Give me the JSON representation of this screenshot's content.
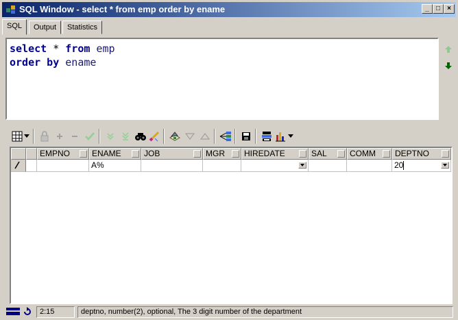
{
  "window": {
    "title": "SQL Window - select * from emp order by ename",
    "controls": [
      "_",
      "□",
      "×"
    ]
  },
  "tabs": [
    {
      "label": "SQL"
    },
    {
      "label": "Output"
    },
    {
      "label": "Statistics"
    }
  ],
  "editor": {
    "line1": {
      "kw1": "select",
      "mid": " * ",
      "kw2": "from",
      "id": " emp"
    },
    "line2": {
      "kw1": "order by",
      "id": " ename"
    }
  },
  "toolbar": {
    "icons": [
      "grid-select-icon",
      "dropdown-icon",
      "lock-icon",
      "add-record-icon",
      "delete-record-icon",
      "post-icon",
      "next-page-icon",
      "last-page-icon",
      "find-icon",
      "clear-icon",
      "query-by-example-icon",
      "filter-icon",
      "sort-icon",
      "export-icon",
      "save-icon",
      "print-icon",
      "chart-icon"
    ]
  },
  "grid": {
    "columns": [
      "EMPNO",
      "ENAME",
      "JOB",
      "MGR",
      "HIREDATE",
      "SAL",
      "COMM",
      "DEPTNO"
    ],
    "row": {
      "EMPNO": "",
      "ENAME": "A%",
      "JOB": "",
      "MGR": "",
      "HIREDATE": "",
      "SAL": "",
      "COMM": "",
      "DEPTNO": "20"
    }
  },
  "status": {
    "position": "2:15",
    "message": "deptno, number(2), optional, The 3 digit number of the department"
  },
  "colors": {
    "title_start": "#0a246a",
    "title_end": "#a6caf0",
    "keyword": "#00008b"
  }
}
